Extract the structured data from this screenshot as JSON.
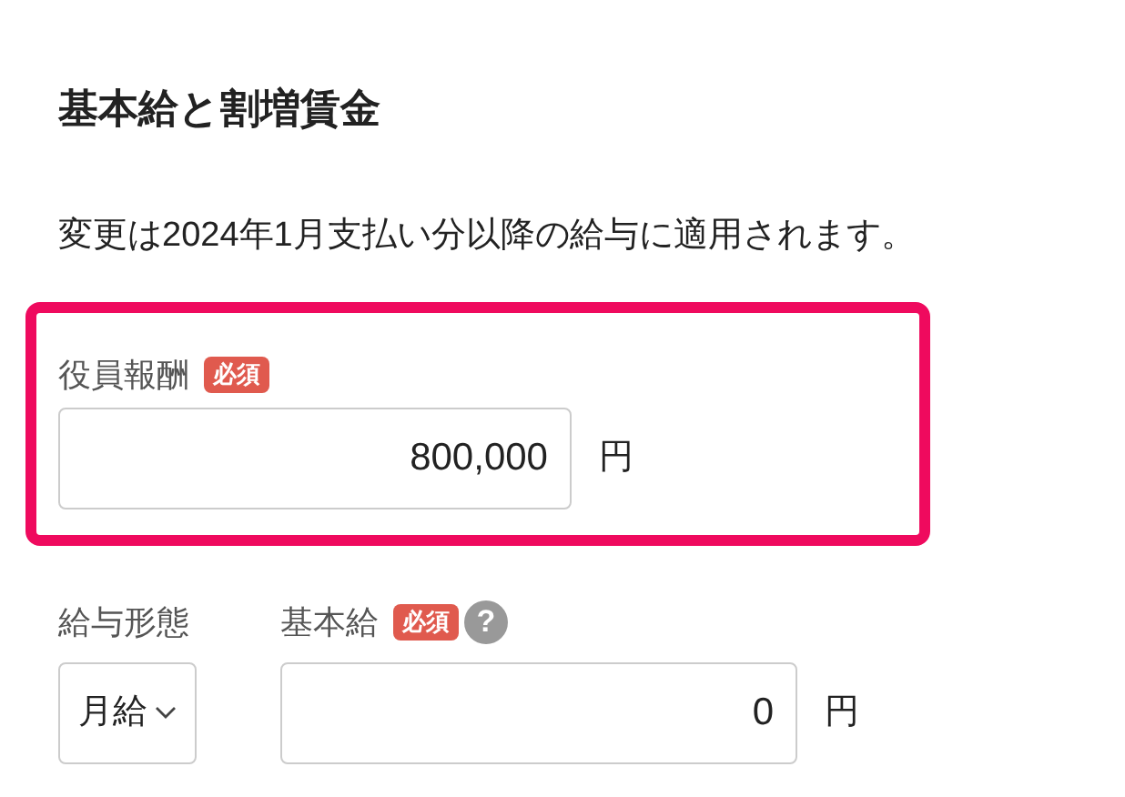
{
  "title": "基本給と割増賃金",
  "description": "変更は2024年1月支払い分以降の給与に適用されます。",
  "officer_pay": {
    "highlighted": true,
    "label": "役員報酬",
    "badge": "必須",
    "value": "800,000",
    "unit": "円"
  },
  "pay_type": {
    "label": "給与形態",
    "value": "月給"
  },
  "base_pay": {
    "label": "基本給",
    "badge": "必須",
    "help": "?",
    "value": "0",
    "unit": "円"
  }
}
